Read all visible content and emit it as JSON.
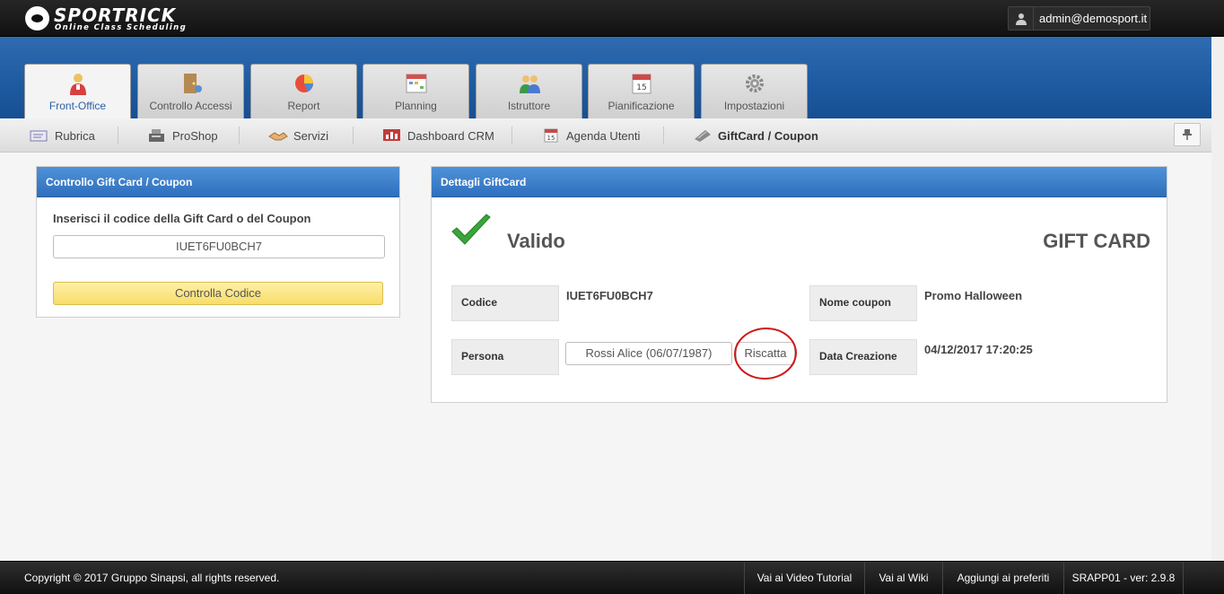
{
  "app": {
    "logo_name": "SPORTRICK",
    "logo_sub": "Online Class Scheduling",
    "user_email": "admin@demosport.it"
  },
  "tabs": [
    {
      "label": "Front-Office",
      "icon": "front-office-person-icon",
      "active": true
    },
    {
      "label": "Controllo Accessi",
      "icon": "door-access-icon"
    },
    {
      "label": "Report",
      "icon": "pie-chart-icon"
    },
    {
      "label": "Planning",
      "icon": "calendar-grid-icon"
    },
    {
      "label": "Istruttore",
      "icon": "instructors-group-icon"
    },
    {
      "label": "Pianificazione",
      "icon": "calendar-15-icon"
    },
    {
      "label": "Impostazioni",
      "icon": "gear-icon"
    }
  ],
  "submenu": [
    {
      "label": "Rubrica",
      "icon": "address-book-icon"
    },
    {
      "label": "ProShop",
      "icon": "cash-register-icon"
    },
    {
      "label": "Servizi",
      "icon": "handshake-icon"
    },
    {
      "label": "Dashboard CRM",
      "icon": "dashboard-chart-icon"
    },
    {
      "label": "Agenda Utenti",
      "icon": "agenda-calendar-icon"
    },
    {
      "label": "GiftCard / Coupon",
      "icon": "giftcard-icon",
      "active": true
    }
  ],
  "left_panel": {
    "title": "Controllo Gift Card / Coupon",
    "prompt": "Inserisci il codice della Gift Card o del Coupon",
    "code_value": "IUET6FU0BCH7",
    "check_button": "Controlla Codice"
  },
  "right_panel": {
    "title": "Dettagli GiftCard",
    "status": "Valido",
    "card_type": "GIFT CARD",
    "code_label": "Codice",
    "code_value": "IUET6FU0BCH7",
    "coupon_name_label": "Nome coupon",
    "coupon_name_value": "Promo Halloween",
    "person_label": "Persona",
    "person_value": "Rossi Alice (06/07/1987)",
    "redeem_button": "Riscatta",
    "created_label": "Data Creazione",
    "created_value": "04/12/2017 17:20:25"
  },
  "footer": {
    "copyright": "Copyright © 2017 Gruppo Sinapsi, all rights reserved.",
    "links": [
      "Vai ai Video Tutorial",
      "Vai al Wiki",
      "Aggiungi ai preferiti"
    ],
    "version": "SRAPP01 - ver: 2.9.8"
  },
  "colors": {
    "accent_blue": "#2f6fbd",
    "button_yellow": "#f8dc68",
    "valid_green": "#3aa53a",
    "highlight_red": "#d01818"
  }
}
